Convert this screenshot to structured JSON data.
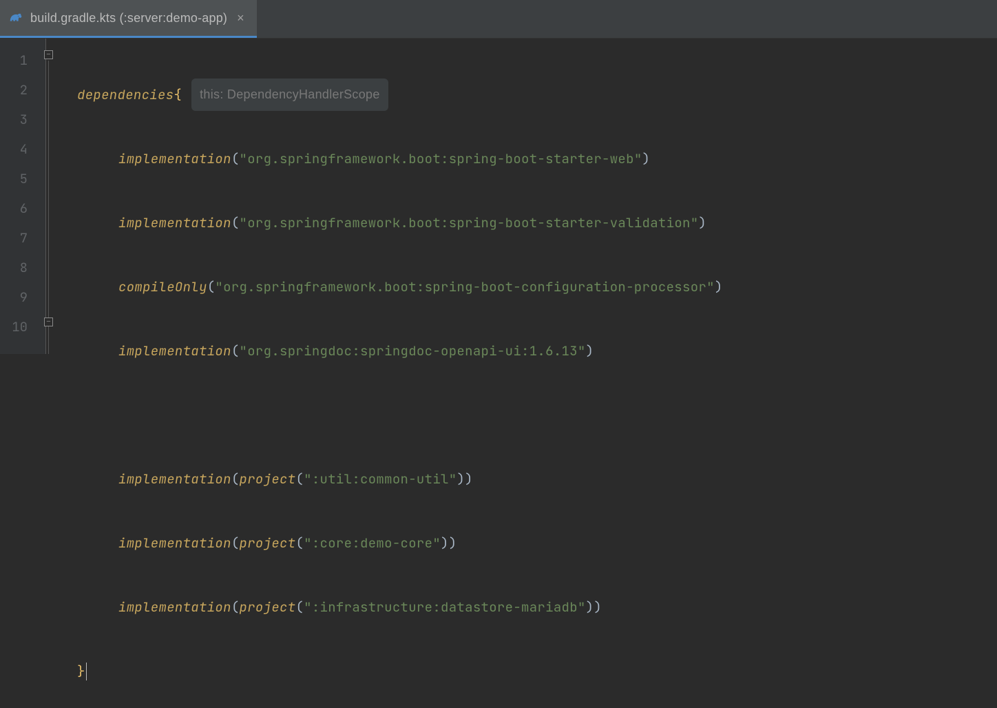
{
  "tab": {
    "label": "build.gradle.kts (:server:demo-app)",
    "close": "×"
  },
  "gutter": [
    "1",
    "2",
    "3",
    "4",
    "5",
    "6",
    "7",
    "8",
    "9",
    "10"
  ],
  "fold": {
    "top": "−",
    "bot": "−"
  },
  "code": {
    "l1": {
      "kw": "dependencies",
      "brace": "{",
      "hint": "this: DependencyHandlerScope"
    },
    "l2": {
      "fn": "implementation",
      "arg": "\"org.springframework.boot:spring-boot-starter-web\""
    },
    "l3": {
      "fn": "implementation",
      "arg": "\"org.springframework.boot:spring-boot-starter-validation\""
    },
    "l4": {
      "fn": "compileOnly",
      "arg": "\"org.springframework.boot:spring-boot-configuration-processor\""
    },
    "l5": {
      "fn": "implementation",
      "arg": "\"org.springdoc:springdoc-openapi-ui:1.6.13\""
    },
    "l7": {
      "fn": "implementation",
      "inner": "project",
      "arg": "\":util:common-util\""
    },
    "l8": {
      "fn": "implementation",
      "inner": "project",
      "arg": "\":core:demo-core\""
    },
    "l9": {
      "fn": "implementation",
      "inner": "project",
      "arg": "\":infrastructure:datastore-mariadb\""
    },
    "l10": {
      "brace": "}"
    }
  }
}
